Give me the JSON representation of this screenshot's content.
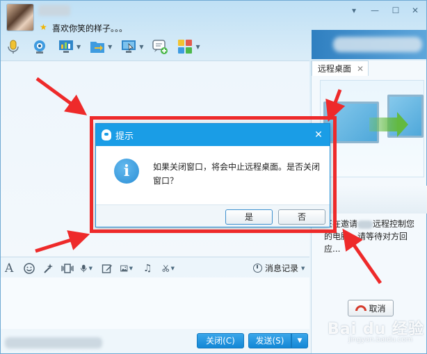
{
  "header": {
    "signature": "喜欢你笑的样子。。。",
    "window_controls": [
      "chevron-down-icon",
      "minimize-icon",
      "maximize-icon",
      "close-icon"
    ]
  },
  "toolbar": {
    "items": [
      "microphone-icon",
      "video-call-icon",
      "share-screen-icon",
      "transfer-file-icon",
      "remote-desktop-icon",
      "create-group-chat-icon",
      "apps-icon"
    ]
  },
  "format_bar": {
    "items": [
      "font-icon",
      "emoji-icon",
      "magic-expression-icon",
      "shake-icon",
      "voice-message-icon",
      "edit-icon",
      "image-icon",
      "music-icon",
      "screenshot-icon"
    ],
    "history_label": "消息记录"
  },
  "buttons": {
    "close_label": "关闭(C)",
    "send_label": "发送(S)"
  },
  "side_panel": {
    "tab_label": "远程桌面",
    "status_prefix": "正在邀请",
    "status_suffix": "远程控制您的电脑，请等待对方回应...",
    "cancel_label": "取消"
  },
  "dialog": {
    "title": "提示",
    "message": "如果关闭窗口，将会中止远程桌面。是否关闭窗口？",
    "yes_label": "是",
    "no_label": "否"
  },
  "watermark": {
    "main": "Bai du 经验",
    "sub": "jingyan.baidu.com"
  },
  "colors": {
    "accent": "#1a9de6",
    "annotation_red": "#ee2a2a"
  }
}
